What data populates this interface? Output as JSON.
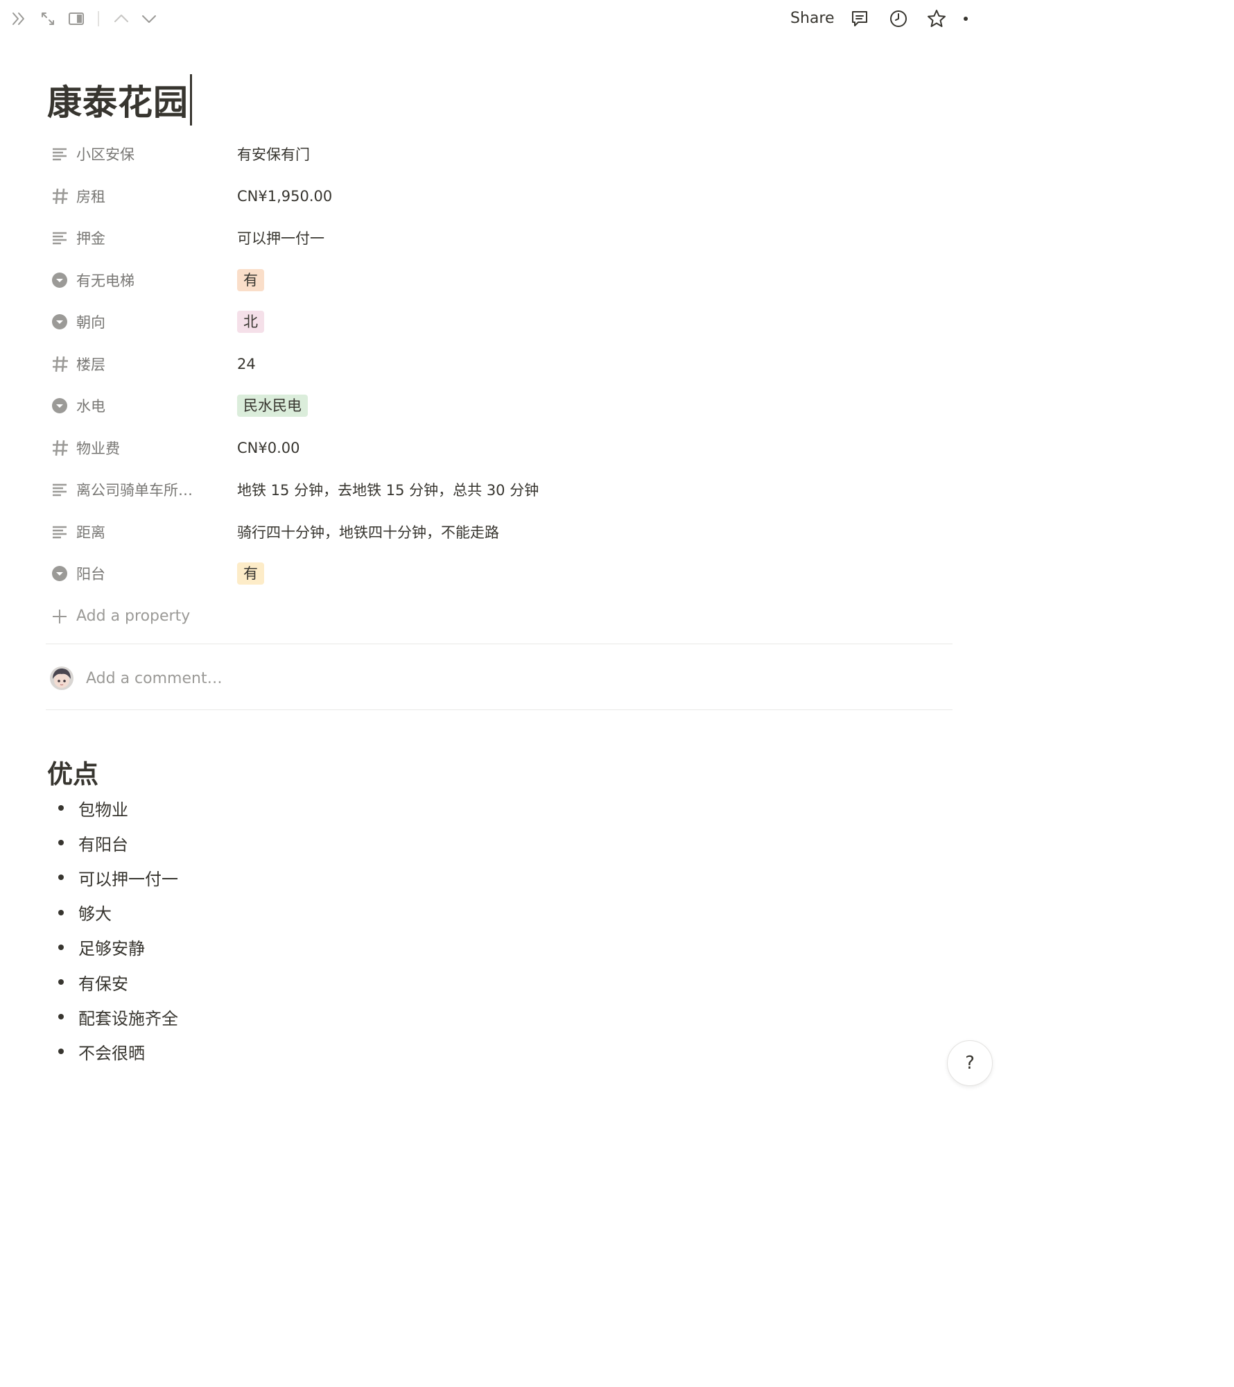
{
  "topbar": {
    "share_label": "Share",
    "icons": [
      "double-chevron-right-icon",
      "expand-arrows-icon",
      "side-peek-icon",
      "chevron-up-icon",
      "chevron-down-icon",
      "comment-icon",
      "clock-history-icon",
      "star-icon",
      "more-dots-icon"
    ]
  },
  "page": {
    "title": "康泰花园"
  },
  "properties": [
    {
      "name": "小区安保",
      "type": "text",
      "icon": "text-lines-icon",
      "value": "有安保有门"
    },
    {
      "name": "房租",
      "type": "number",
      "icon": "hash-icon",
      "value": "CN¥1,950.00"
    },
    {
      "name": "押金",
      "type": "text",
      "icon": "text-lines-icon",
      "value": "可以押一付一"
    },
    {
      "name": "有无电梯",
      "type": "select",
      "icon": "select-icon",
      "value": "有",
      "tag_bg": "#fadec9",
      "tag_fg": "#37352f"
    },
    {
      "name": "朝向",
      "type": "select",
      "icon": "select-icon",
      "value": "北",
      "tag_bg": "#f5e0e9",
      "tag_fg": "#37352f"
    },
    {
      "name": "楼层",
      "type": "number",
      "icon": "hash-icon",
      "value": "24"
    },
    {
      "name": "水电",
      "type": "select",
      "icon": "select-icon",
      "value": "民水民电",
      "tag_bg": "#dbeddb",
      "tag_fg": "#37352f"
    },
    {
      "name": "物业费",
      "type": "number",
      "icon": "hash-icon",
      "value": "CN¥0.00"
    },
    {
      "name": "离公司骑单车所…",
      "type": "text",
      "icon": "text-lines-icon",
      "value": "地铁 15 分钟，去地铁 15 分钟，总共 30 分钟"
    },
    {
      "name": "距离",
      "type": "text",
      "icon": "text-lines-icon",
      "value": "骑行四十分钟，地铁四十分钟，不能走路"
    },
    {
      "name": "阳台",
      "type": "select",
      "icon": "select-icon",
      "value": "有",
      "tag_bg": "#fdecc8",
      "tag_fg": "#37352f"
    }
  ],
  "add_property_label": "Add a property",
  "comment": {
    "placeholder": "Add a comment…"
  },
  "section": {
    "heading": "优点",
    "bullets": [
      "包物业",
      "有阳台",
      "可以押一付一",
      "够大",
      "足够安静",
      "有保安",
      "配套设施齐全",
      "不会很晒"
    ]
  },
  "help_label": "?"
}
